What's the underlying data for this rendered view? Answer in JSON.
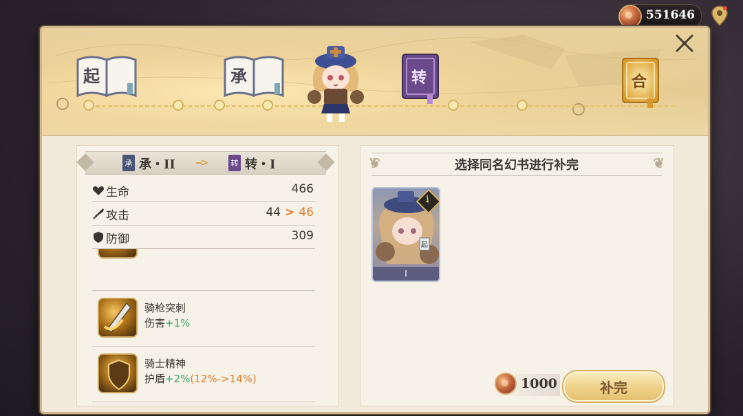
{
  "hud": {
    "currency_amount": "551646",
    "currency_icon": "gold-coin-icon",
    "map_icon": "map-pin-icon",
    "close_icon": "close-icon"
  },
  "banner": {
    "books": [
      {
        "label": "起",
        "style": "white-book"
      },
      {
        "label": "承",
        "style": "white-book"
      },
      {
        "label": "转",
        "style": "purple-book"
      },
      {
        "label": "合",
        "style": "gold-book"
      }
    ]
  },
  "left_panel": {
    "stage_from": "承・II",
    "stage_from_icon": "承",
    "stage_to": "转・I",
    "stage_to_icon": "转",
    "arrow": "-->",
    "stats": [
      {
        "label": "生命",
        "icon": "heart-icon",
        "value": "466"
      },
      {
        "label": "攻击",
        "icon": "sword-icon",
        "old": "44",
        "arrow": ">",
        "new": "46"
      },
      {
        "label": "防御",
        "icon": "shield-icon",
        "value": "309"
      }
    ],
    "skills": [
      {
        "name": "骑枪突刺",
        "desc_prefix": "伤害",
        "desc_green": "+1%",
        "desc_orange": ""
      },
      {
        "name": "骑士精神",
        "desc_prefix": "护盾",
        "desc_green": "+2%",
        "desc_orange": "(12%->14%)"
      }
    ]
  },
  "right_panel": {
    "title": "选择同名幻书进行补完",
    "card": {
      "corner_label": "起",
      "footer": "I"
    },
    "cost": "1000",
    "button_label": "补完"
  },
  "colors": {
    "frame": "#f1eadb",
    "accent_orange": "#e07b2d",
    "accent_green": "#3aa36f",
    "gold": "#d4a24a",
    "purple_book": "#6b4a8c"
  }
}
